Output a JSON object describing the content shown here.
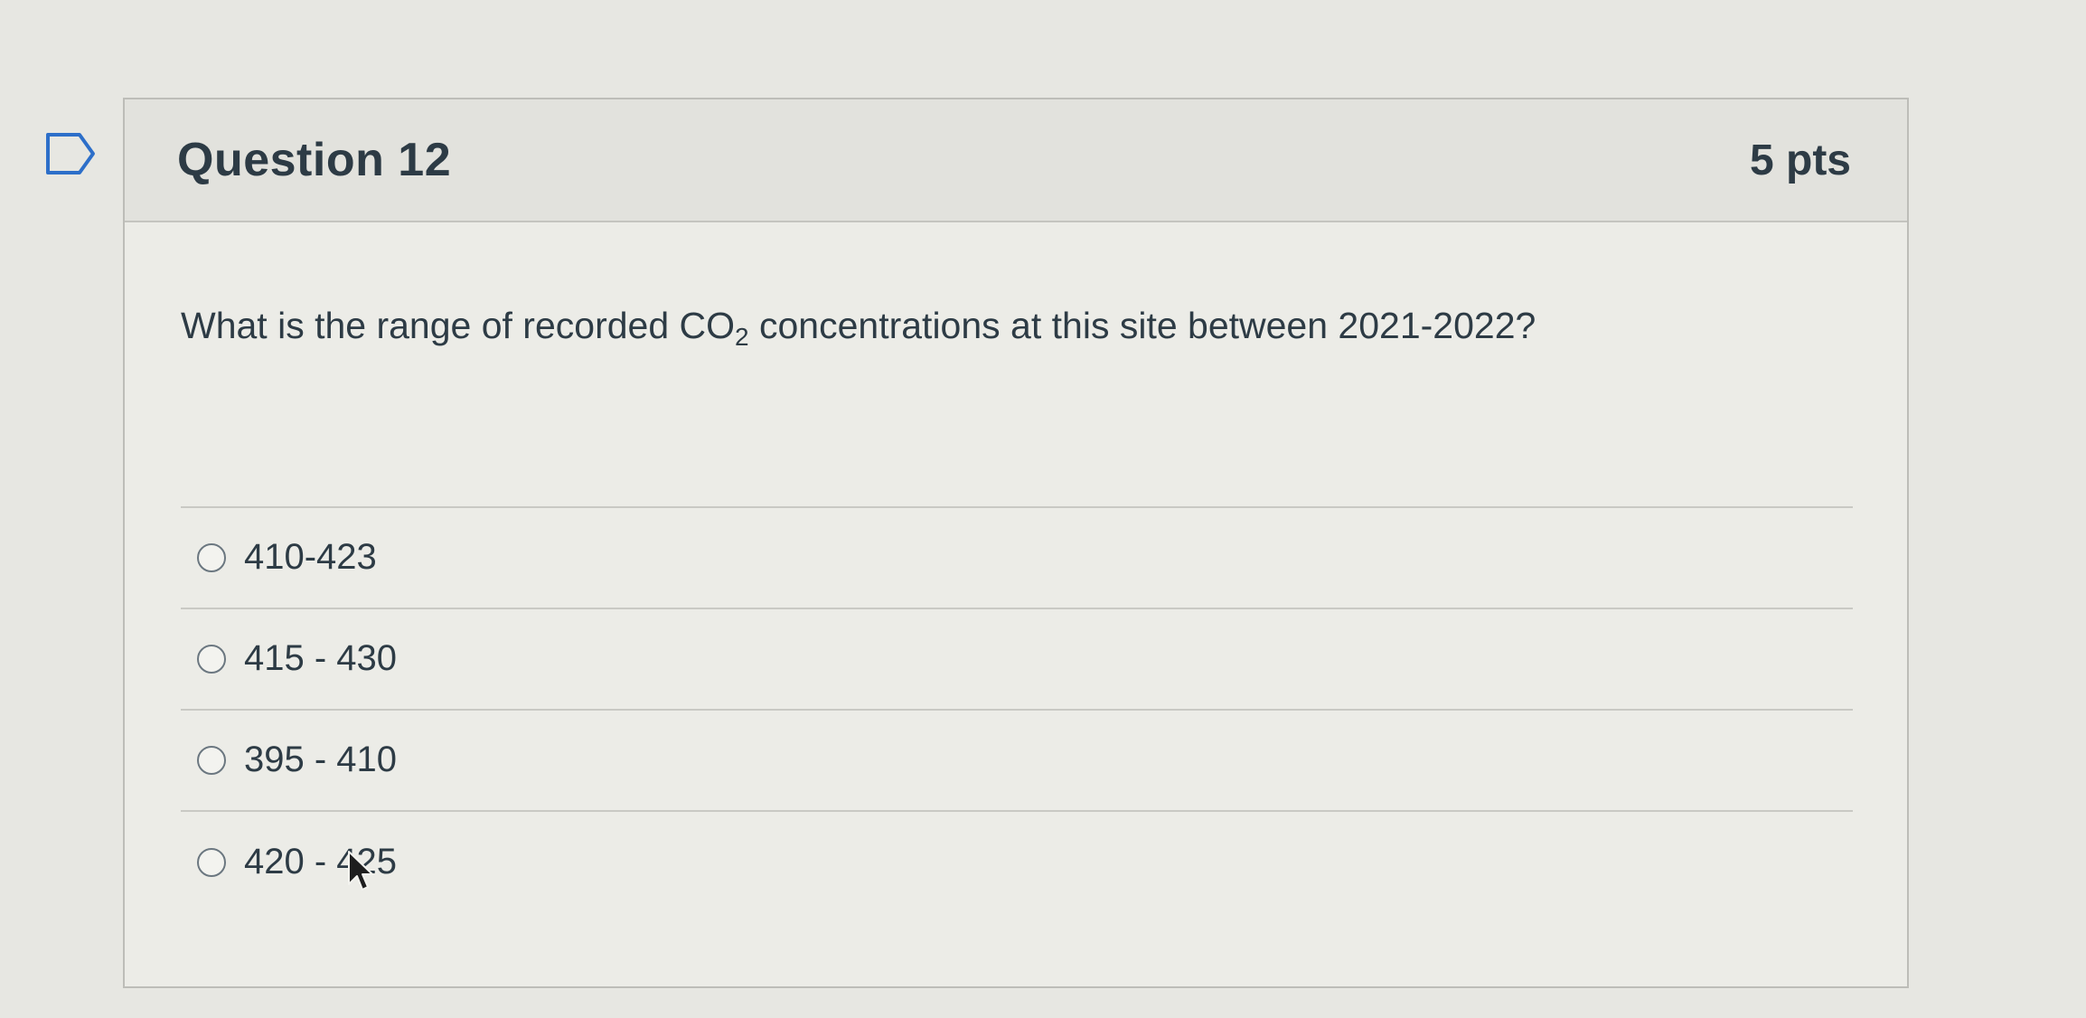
{
  "question": {
    "title": "Question 12",
    "points": "5 pts",
    "text_prefix": "What is the range of recorded CO",
    "text_subscript": "2",
    "text_suffix": " concentrations at this site between 2021-2022?"
  },
  "answers": [
    {
      "label": "410-423",
      "selected": false
    },
    {
      "label": "415 - 430",
      "selected": false
    },
    {
      "label": "395 - 410",
      "selected": false
    },
    {
      "label": "420 - 425",
      "selected": false
    }
  ],
  "icons": {
    "bookmark": "bookmark-flag-icon",
    "cursor": "mouse-pointer-icon"
  }
}
